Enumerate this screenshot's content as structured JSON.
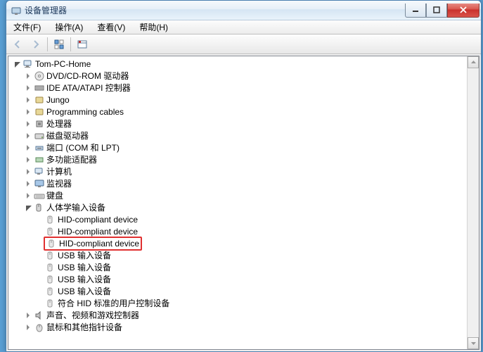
{
  "window": {
    "title": "设备管理器"
  },
  "menu": {
    "file": "文件(F)",
    "action": "操作(A)",
    "view": "查看(V)",
    "help": "帮助(H)"
  },
  "tree": {
    "root": "Tom-PC-Home",
    "categories": [
      {
        "label": "DVD/CD-ROM 驱动器",
        "iconKey": "disc",
        "expanded": false
      },
      {
        "label": "IDE ATA/ATAPI 控制器",
        "iconKey": "ide",
        "expanded": false
      },
      {
        "label": "Jungo",
        "iconKey": "generic",
        "expanded": false
      },
      {
        "label": "Programming cables",
        "iconKey": "generic",
        "expanded": false
      },
      {
        "label": "处理器",
        "iconKey": "cpu",
        "expanded": false
      },
      {
        "label": "磁盘驱动器",
        "iconKey": "disk",
        "expanded": false
      },
      {
        "label": "端口 (COM 和 LPT)",
        "iconKey": "port",
        "expanded": false
      },
      {
        "label": "多功能适配器",
        "iconKey": "adapter",
        "expanded": false
      },
      {
        "label": "计算机",
        "iconKey": "computer",
        "expanded": false
      },
      {
        "label": "监视器",
        "iconKey": "monitor",
        "expanded": false
      },
      {
        "label": "键盘",
        "iconKey": "keyboard",
        "expanded": false
      },
      {
        "label": "人体学输入设备",
        "iconKey": "hid",
        "expanded": true,
        "children": [
          {
            "label": "HID-compliant device",
            "iconKey": "hid-dev",
            "highlight": false
          },
          {
            "label": "HID-compliant device",
            "iconKey": "hid-dev",
            "highlight": false
          },
          {
            "label": "HID-compliant device",
            "iconKey": "hid-dev",
            "highlight": true
          },
          {
            "label": "USB 输入设备",
            "iconKey": "hid-dev",
            "highlight": false
          },
          {
            "label": "USB 输入设备",
            "iconKey": "hid-dev",
            "highlight": false
          },
          {
            "label": "USB 输入设备",
            "iconKey": "hid-dev",
            "highlight": false
          },
          {
            "label": "USB 输入设备",
            "iconKey": "hid-dev",
            "highlight": false
          },
          {
            "label": "符合 HID 标准的用户控制设备",
            "iconKey": "hid-dev",
            "highlight": false
          }
        ]
      },
      {
        "label": "声音、视频和游戏控制器",
        "iconKey": "sound",
        "expanded": false
      },
      {
        "label": "鼠标和其他指针设备",
        "iconKey": "mouse",
        "expanded": false
      }
    ]
  }
}
